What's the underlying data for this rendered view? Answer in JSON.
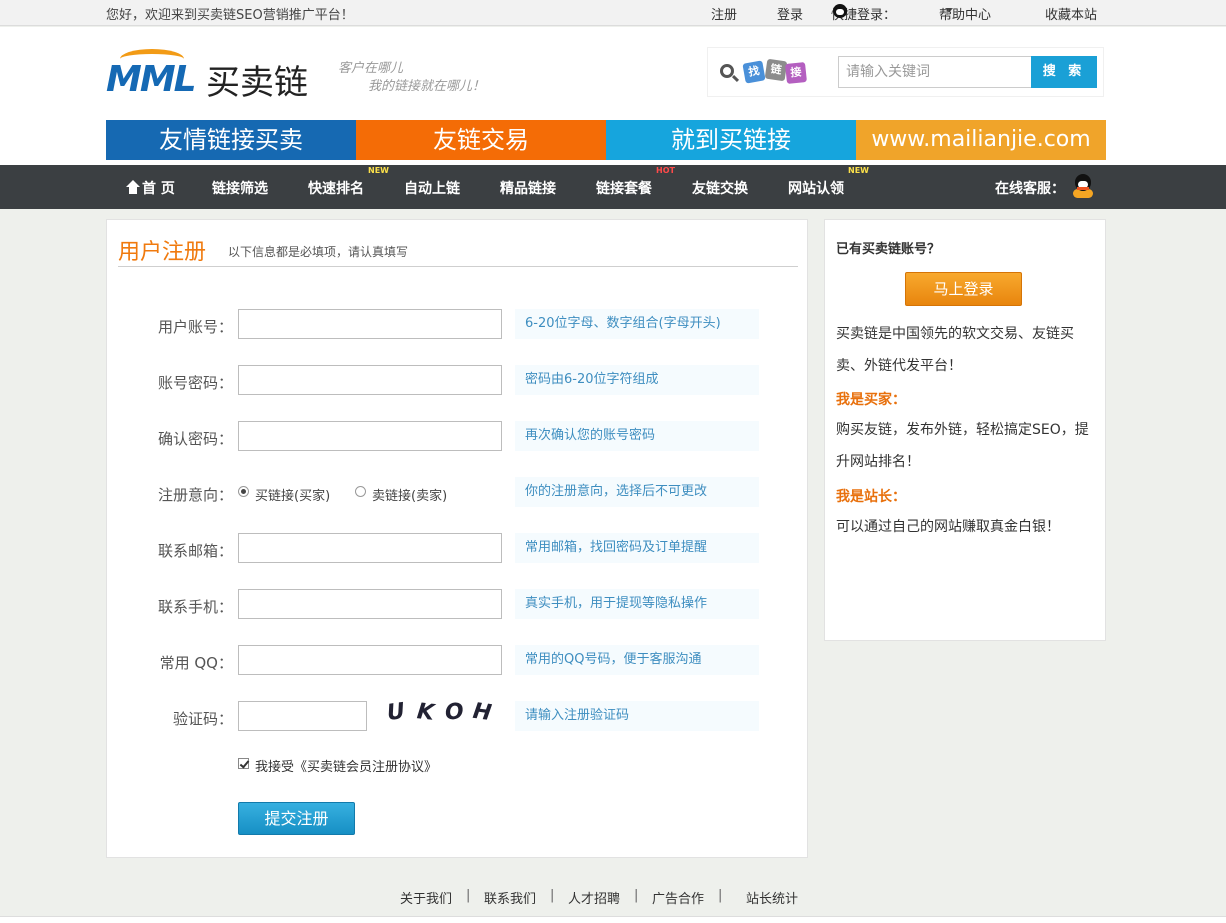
{
  "topbar": {
    "welcome": "您好，欢迎来到买卖链SEO营销推广平台！",
    "register": "注册",
    "login": "登录",
    "quick_login": "快捷登录：",
    "help": "帮助中心",
    "favorite": "收藏本站"
  },
  "header": {
    "logo_latin": "MML",
    "logo_cn": "买卖链",
    "slogan_line1": "客户在哪儿",
    "slogan_line2": "我的链接就在哪儿！",
    "search_tags": [
      "找",
      "链",
      "接"
    ],
    "search_placeholder": "请输入关键词",
    "search_button": "搜 索"
  },
  "banner": [
    "友情链接买卖",
    "友链交易",
    "就到买链接",
    "www.mailianjie.com"
  ],
  "nav": {
    "items": [
      "首 页",
      "链接筛选",
      "快速排名",
      "自动上链",
      "精品链接",
      "链接套餐",
      "友链交换",
      "网站认领"
    ],
    "badge_new": "NEW",
    "badge_hot": "HOT",
    "service": "在线客服："
  },
  "form": {
    "title": "用户注册",
    "subtitle": "以下信息都是必填项，请认真填写",
    "fields": [
      {
        "label": "用户账号：",
        "hint": "6-20位字母、数字组合(字母开头)"
      },
      {
        "label": "账号密码：",
        "hint": "密码由6-20位字符组成"
      },
      {
        "label": "确认密码：",
        "hint": "再次确认您的账号密码"
      },
      {
        "label": "注册意向：",
        "hint": "你的注册意向，选择后不可更改"
      },
      {
        "label": "联系邮箱：",
        "hint": "常用邮箱，找回密码及订单提醒"
      },
      {
        "label": "联系手机：",
        "hint": "真实手机，用于提现等隐私操作"
      },
      {
        "label": "常用 QQ：",
        "hint": "常用的QQ号码，便于客服沟通"
      },
      {
        "label": "验证码：",
        "hint": "请输入注册验证码"
      }
    ],
    "intent_buy": "买链接(买家)",
    "intent_sell": "卖链接(卖家)",
    "captcha_chars": [
      "U",
      "K",
      "O",
      "H"
    ],
    "agree": "我接受《买卖链会员注册协议》",
    "submit": "提交注册"
  },
  "sidebar": {
    "question": "已有买卖链账号？",
    "login_button": "马上登录",
    "intro": "买卖链是中国领先的软文交易、友链买卖、外链代发平台！",
    "buyer_title": "我是买家：",
    "buyer_text": "购买友链，发布外链，轻松搞定SEO，提升网站排名！",
    "owner_title": "我是站长：",
    "owner_text": "可以通过自己的网站赚取真金白银！"
  },
  "footer": {
    "links": [
      "关于我们",
      "联系我们",
      "人才招聘",
      "广告合作",
      "站长统计"
    ],
    "separator": "|"
  }
}
